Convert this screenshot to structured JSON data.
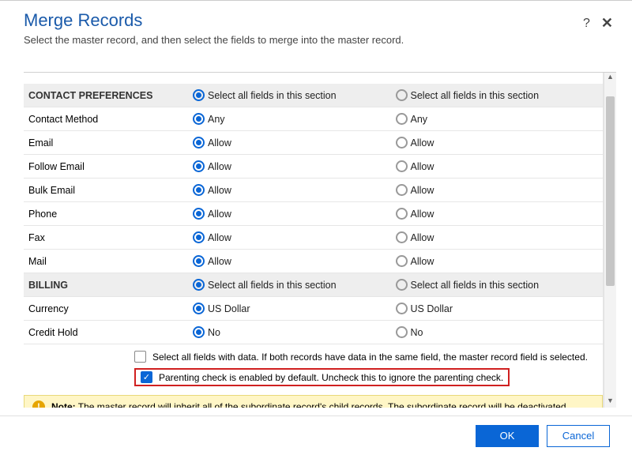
{
  "header": {
    "title": "Merge Records",
    "subtitle": "Select the master record, and then select the fields to merge into the master record."
  },
  "sections": {
    "contact": {
      "title": "CONTACT PREFERENCES",
      "select_all": "Select all fields in this section",
      "rows": [
        {
          "label": "Contact Method",
          "a": "Any",
          "b": "Any"
        },
        {
          "label": "Email",
          "a": "Allow",
          "b": "Allow"
        },
        {
          "label": "Follow Email",
          "a": "Allow",
          "b": "Allow"
        },
        {
          "label": "Bulk Email",
          "a": "Allow",
          "b": "Allow"
        },
        {
          "label": "Phone",
          "a": "Allow",
          "b": "Allow"
        },
        {
          "label": "Fax",
          "a": "Allow",
          "b": "Allow"
        },
        {
          "label": "Mail",
          "a": "Allow",
          "b": "Allow"
        }
      ]
    },
    "billing": {
      "title": "BILLING",
      "select_all": "Select all fields in this section",
      "rows": [
        {
          "label": "Currency",
          "a": "US Dollar",
          "b": "US Dollar"
        },
        {
          "label": "Credit Hold",
          "a": "No",
          "b": "No"
        }
      ]
    }
  },
  "options": {
    "select_all_data": "Select all fields with data. If both records have data in the same field, the master record field is selected.",
    "parenting_check": "Parenting check is enabled by default. Uncheck this to ignore the parenting check."
  },
  "note": {
    "label": "Note:",
    "text": "The master record will inherit all of the subordinate record's child records. The subordinate record will be deactivated."
  },
  "footer": {
    "ok": "OK",
    "cancel": "Cancel"
  }
}
